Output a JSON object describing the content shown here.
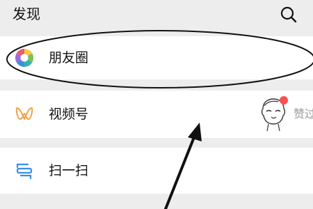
{
  "header": {
    "title": "发现",
    "search_icon": "search-icon"
  },
  "items": [
    {
      "label": "朋友圈",
      "icon": "moments-aperture-icon"
    },
    {
      "label": "视频号",
      "icon": "channels-icon",
      "right_text": "赞过",
      "right_avatar": "avatar-sticker",
      "badge_color": "#fa5151"
    },
    {
      "label": "扫一扫",
      "icon": "scan-icon"
    }
  ],
  "colors": {
    "background": "#ededed",
    "row": "#ffffff",
    "text": "#111111",
    "secondary_text": "#999999",
    "channels_accent": "#f0a04b",
    "scan_accent": "#3a8ee6",
    "badge": "#fa5151"
  },
  "annotations": {
    "ellipse": "highlight-ellipse",
    "arrow": "pointer-arrow"
  }
}
